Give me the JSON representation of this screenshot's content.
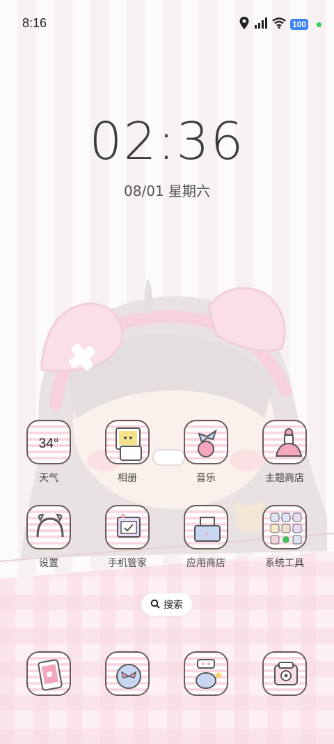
{
  "status_bar": {
    "time": "8:16",
    "battery": "100"
  },
  "lockscreen": {
    "clock": "02:36",
    "date": "08/01 星期六"
  },
  "apps_row1": [
    {
      "label": "天气",
      "icon": "weather-icon",
      "value": "34°"
    },
    {
      "label": "相册",
      "icon": "photo-album-icon"
    },
    {
      "label": "音乐",
      "icon": "music-icon"
    },
    {
      "label": "主题商店",
      "icon": "theme-store-icon"
    }
  ],
  "apps_row2": [
    {
      "label": "设置",
      "icon": "settings-icon"
    },
    {
      "label": "手机管家",
      "icon": "phone-manager-icon"
    },
    {
      "label": "应用商店",
      "icon": "app-store-icon"
    },
    {
      "label": "系统工具",
      "icon": "system-tools-folder-icon"
    }
  ],
  "search": {
    "label": "搜索"
  },
  "dock": [
    {
      "icon": "phone-icon"
    },
    {
      "icon": "messages-icon"
    },
    {
      "icon": "camera-app-icon"
    },
    {
      "icon": "browser-icon"
    }
  ],
  "colors": {
    "accent_pink": "#f9d8e4",
    "battery_blue": "#3b82f6",
    "status_green": "#35c759"
  }
}
